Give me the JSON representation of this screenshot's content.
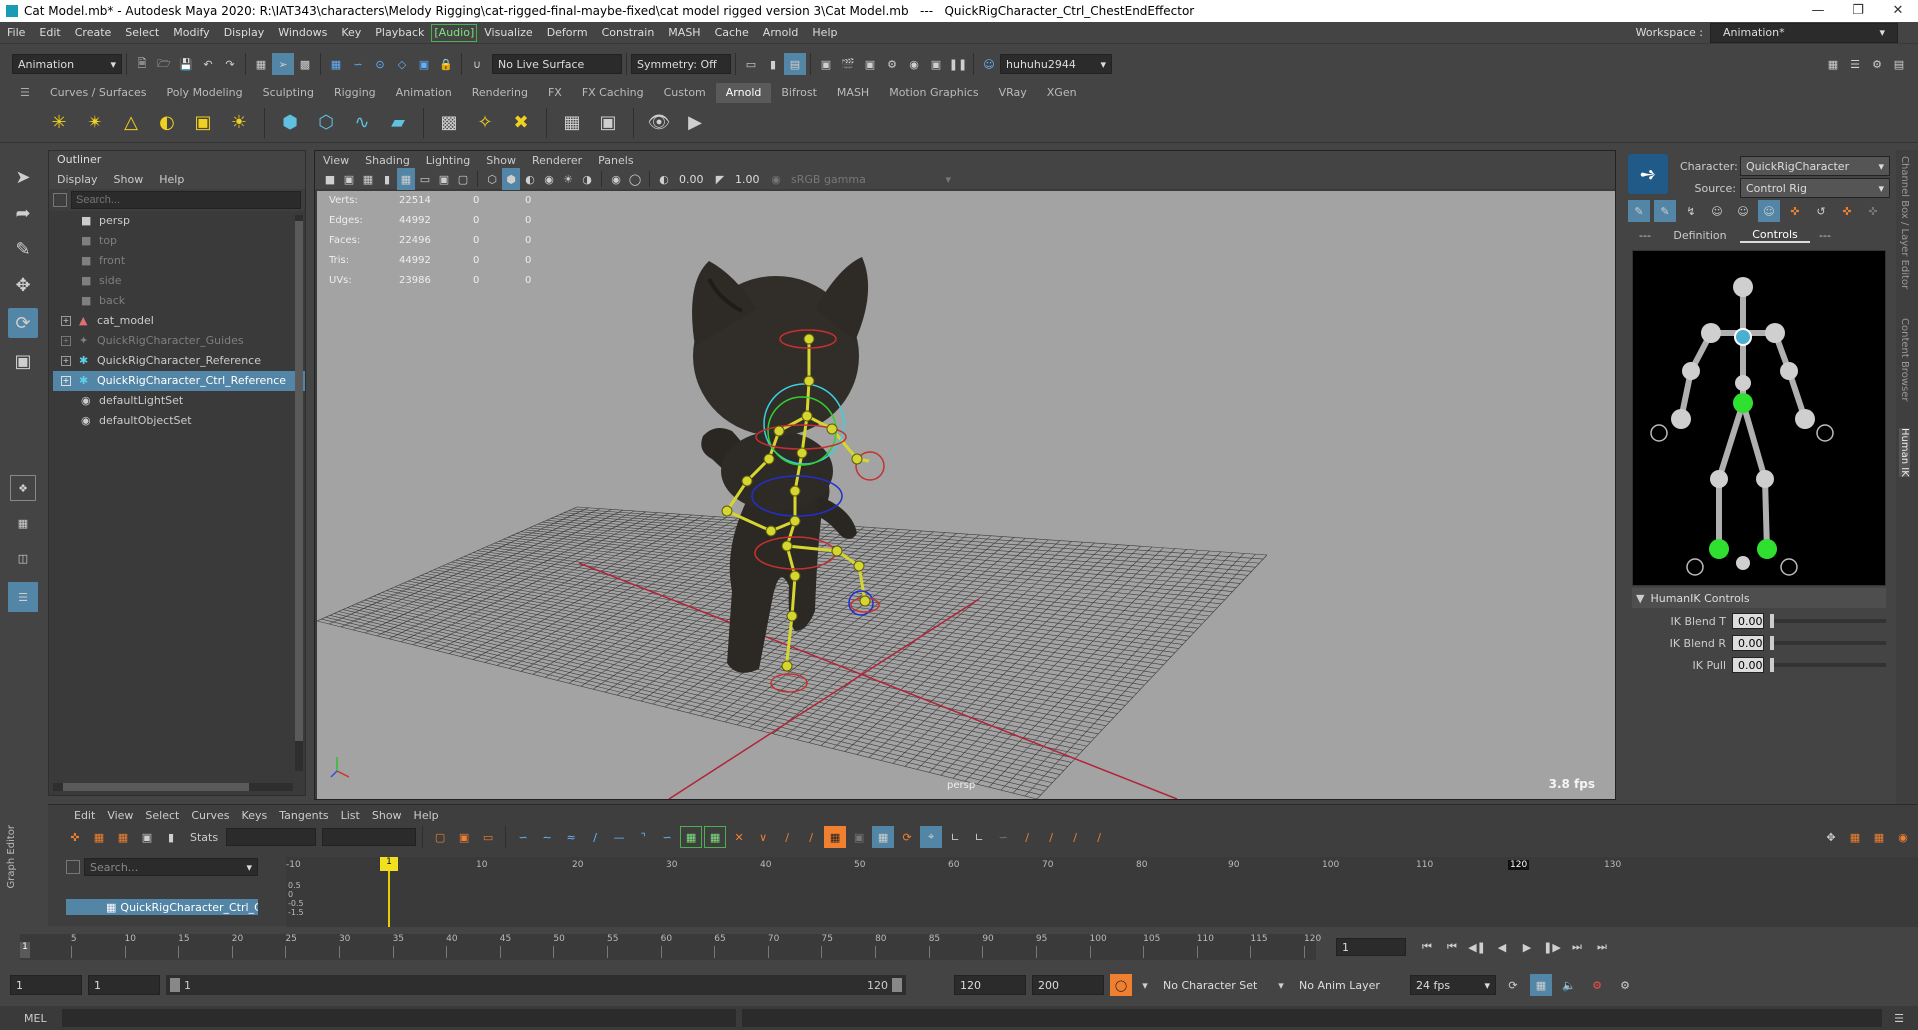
{
  "title": {
    "text": "Cat Model.mb* - Autodesk Maya 2020: R:\\IAT343\\characters\\Melody Rigging\\cat-rigged-final-maybe-fixed\\cat model rigged version 3\\Cat Model.mb   ---   QuickRigCharacter_Ctrl_ChestEndEffector"
  },
  "menubar": {
    "items": [
      "File",
      "Edit",
      "Create",
      "Select",
      "Modify",
      "Display",
      "Windows",
      "Key",
      "Playback",
      "[Audio]",
      "Visualize",
      "Deform",
      "Constrain",
      "MASH",
      "Cache",
      "Arnold",
      "Help"
    ],
    "workspace_label": "Workspace :",
    "workspace_value": "Animation*"
  },
  "statusline": {
    "mode": "Animation",
    "live_surface": "No Live Surface",
    "symmetry": "Symmetry: Off",
    "user": "huhuhu2944"
  },
  "shelf": {
    "tabs": [
      "Curves / Surfaces",
      "Poly Modeling",
      "Sculpting",
      "Rigging",
      "Animation",
      "Rendering",
      "FX",
      "FX Caching",
      "Custom",
      "Arnold",
      "Bifrost",
      "MASH",
      "Motion Graphics",
      "VRay",
      "XGen"
    ],
    "active": "Arnold"
  },
  "outliner": {
    "title": "Outliner",
    "menu": [
      "Display",
      "Show",
      "Help"
    ],
    "search_placeholder": "Search...",
    "items": [
      {
        "label": "persp",
        "state": "normal"
      },
      {
        "label": "top",
        "state": "dim"
      },
      {
        "label": "front",
        "state": "dim"
      },
      {
        "label": "side",
        "state": "dim"
      },
      {
        "label": "back",
        "state": "dim"
      },
      {
        "label": "cat_model",
        "state": "normal"
      },
      {
        "label": "QuickRigCharacter_Guides",
        "state": "dim"
      },
      {
        "label": "QuickRigCharacter_Reference",
        "state": "normal"
      },
      {
        "label": "QuickRigCharacter_Ctrl_Reference",
        "state": "selected"
      },
      {
        "label": "defaultLightSet",
        "state": "normal"
      },
      {
        "label": "defaultObjectSet",
        "state": "normal"
      }
    ]
  },
  "viewport": {
    "menu": [
      "View",
      "Shading",
      "Lighting",
      "Show",
      "Renderer",
      "Panels"
    ],
    "exposure": "0.00",
    "gamma": "1.00",
    "colorspace": "sRGB gamma",
    "camera": "persp",
    "fps": "3.8 fps",
    "stats": [
      {
        "label": "Verts:",
        "a": "22514",
        "b": "0",
        "c": "0"
      },
      {
        "label": "Edges:",
        "a": "44992",
        "b": "0",
        "c": "0"
      },
      {
        "label": "Faces:",
        "a": "22496",
        "b": "0",
        "c": "0"
      },
      {
        "label": "Tris:",
        "a": "44992",
        "b": "0",
        "c": "0"
      },
      {
        "label": "UVs:",
        "a": "23986",
        "b": "0",
        "c": "0"
      }
    ]
  },
  "hik": {
    "character_label": "Character:",
    "character": "QuickRigCharacter",
    "source_label": "Source:",
    "source": "Control Rig",
    "tabs": [
      "---",
      "Definition",
      "Controls",
      "---"
    ],
    "active_tab": "Controls",
    "controls_header": "HumanIK Controls",
    "sliders": [
      {
        "label": "IK Blend T",
        "value": "0.00"
      },
      {
        "label": "IK Blend R",
        "value": "0.00"
      },
      {
        "label": "IK Pull",
        "value": "0.00"
      }
    ]
  },
  "sidebar": {
    "tabs": [
      "Channel Box / Layer Editor",
      "Content Browser",
      "Human IK"
    ]
  },
  "graph": {
    "menu": [
      "Edit",
      "View",
      "Select",
      "Curves",
      "Keys",
      "Tangents",
      "List",
      "Show",
      "Help"
    ],
    "stats_label": "Stats",
    "search_placeholder": "Search...",
    "item": "QuickRigCharacter_Ctrl_Ch",
    "panel_label": "Graph Editor",
    "ruler": [
      "-10",
      "1",
      "10",
      "20",
      "30",
      "40",
      "50",
      "60",
      "70",
      "80",
      "90",
      "100",
      "110",
      "120",
      "130"
    ],
    "yvals": [
      "0.5",
      "0",
      "-0.5",
      "-1.5"
    ],
    "current_frame": "1",
    "end_marker": "120"
  },
  "timeslider": {
    "ticks": [
      "5",
      "10",
      "15",
      "20",
      "25",
      "30",
      "35",
      "40",
      "45",
      "50",
      "55",
      "60",
      "65",
      "70",
      "75",
      "80",
      "85",
      "90",
      "95",
      "100",
      "105",
      "110",
      "115",
      "120"
    ],
    "current": "1",
    "frame_field": "1"
  },
  "range": {
    "start": "1",
    "playback_start": "1",
    "slider_start": "1",
    "slider_end": "120",
    "playback_end": "120",
    "end": "200",
    "character_set": "No Character Set",
    "anim_layer": "No Anim Layer",
    "fps": "24 fps"
  },
  "cmd": {
    "label": "MEL"
  }
}
